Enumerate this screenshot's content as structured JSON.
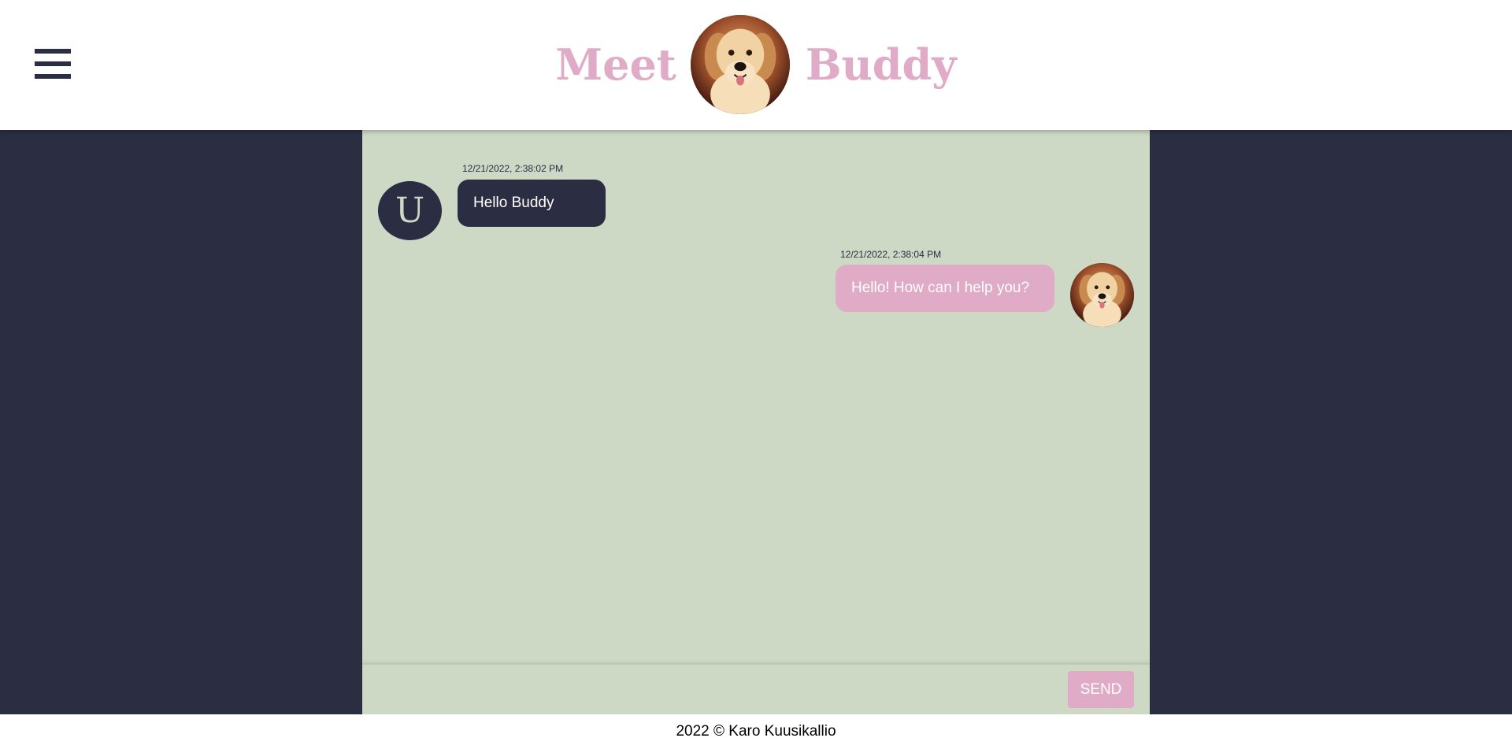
{
  "header": {
    "menu_icon": "hamburger-menu-icon",
    "brand_left": "Meet",
    "brand_right": "Buddy",
    "brand_avatar_icon": "golden-retriever-avatar",
    "colors": {
      "brand": "#e0abc6",
      "dark": "#2b2d42",
      "chat_bg": "#cdd8c5"
    }
  },
  "chat": {
    "messages": [
      {
        "sender": "user",
        "avatar_letter": "U",
        "timestamp": "12/21/2022, 2:38:02 PM",
        "text": "Hello Buddy"
      },
      {
        "sender": "bot",
        "avatar_icon": "golden-retriever-avatar",
        "timestamp": "12/21/2022, 2:38:04 PM",
        "text": "Hello! How can I help you?"
      }
    ]
  },
  "composer": {
    "input_value": "",
    "send_label": "SEND"
  },
  "footer": {
    "text": "2022 © Karo Kuusikallio"
  }
}
